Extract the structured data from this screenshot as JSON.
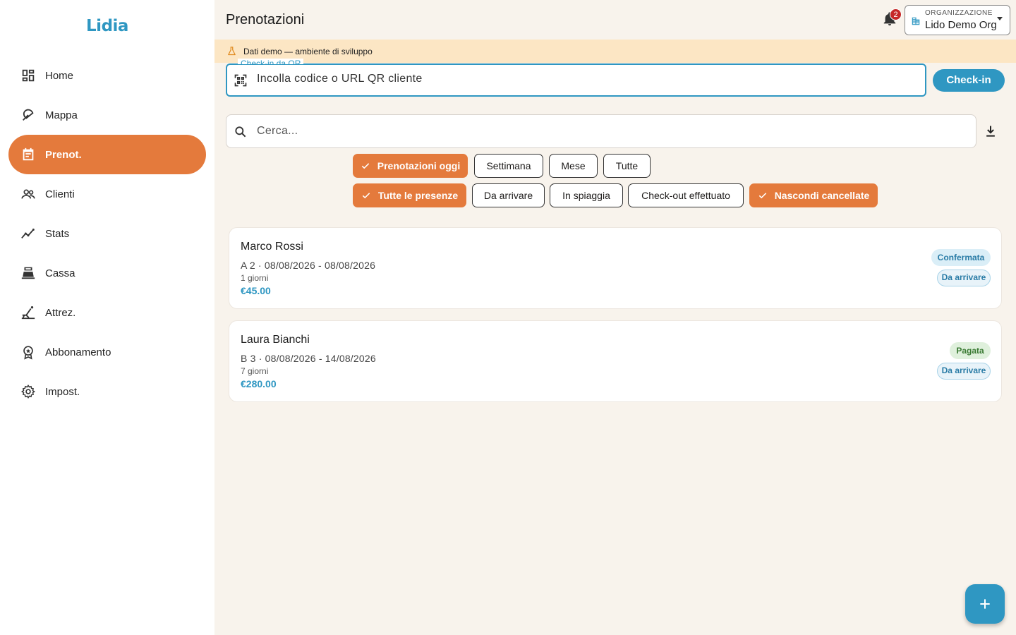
{
  "app": {
    "brand": "Lidia"
  },
  "sidebar": {
    "items": [
      {
        "label": "Home",
        "icon": "dashboard-icon",
        "active": false
      },
      {
        "label": "Mappa",
        "icon": "beach-umbrella-icon",
        "active": false
      },
      {
        "label": "Prenot.",
        "icon": "calendar-icon",
        "active": true
      },
      {
        "label": "Clienti",
        "icon": "people-icon",
        "active": false
      },
      {
        "label": "Stats",
        "icon": "trend-chart-icon",
        "active": false
      },
      {
        "label": "Cassa",
        "icon": "cash-register-icon",
        "active": false
      },
      {
        "label": "Attrez.",
        "icon": "deck-chair-icon",
        "active": false
      },
      {
        "label": "Abbonamento",
        "icon": "award-icon",
        "active": false
      },
      {
        "label": "Impost.",
        "icon": "gear-icon",
        "active": false
      }
    ]
  },
  "header": {
    "title": "Prenotazioni",
    "notifications_count": "2",
    "org_label": "ORGANIZZAZIONE",
    "org_value": "Lido Demo Org"
  },
  "banner": {
    "text": "Dati demo — ambiente di sviluppo"
  },
  "qr": {
    "label": "Check-in da QR",
    "placeholder": "Incolla codice o URL QR cliente",
    "button": "Check-in"
  },
  "search": {
    "placeholder": "Cerca..."
  },
  "filters": {
    "period": [
      {
        "label": "Prenotazioni oggi",
        "selected": true
      },
      {
        "label": "Settimana",
        "selected": false
      },
      {
        "label": "Mese",
        "selected": false
      },
      {
        "label": "Tutte",
        "selected": false
      }
    ],
    "presence": [
      {
        "label": "Tutte le presenze",
        "selected": true
      },
      {
        "label": "Da arrivare",
        "selected": false
      },
      {
        "label": "In spiaggia",
        "selected": false
      },
      {
        "label": "Check-out effettuato",
        "selected": false
      },
      {
        "label": "Nascondi cancellate",
        "selected": true
      }
    ]
  },
  "bookings": [
    {
      "name": "Marco Rossi",
      "dates": "A 2 · 08/08/2026 - 08/08/2026",
      "days": "1 giorni",
      "price": "€45.00",
      "status": "Confermata",
      "presence": "Da arrivare"
    },
    {
      "name": "Laura Bianchi",
      "dates": "B 3 · 08/08/2026 - 14/08/2026",
      "days": "7 giorni",
      "price": "€280.00",
      "status": "Pagata",
      "presence": "Da arrivare"
    }
  ],
  "colors": {
    "accent": "#e47a3c",
    "primary": "#2f97c2",
    "banner": "#fce6c4",
    "background": "#f8f3ec"
  }
}
